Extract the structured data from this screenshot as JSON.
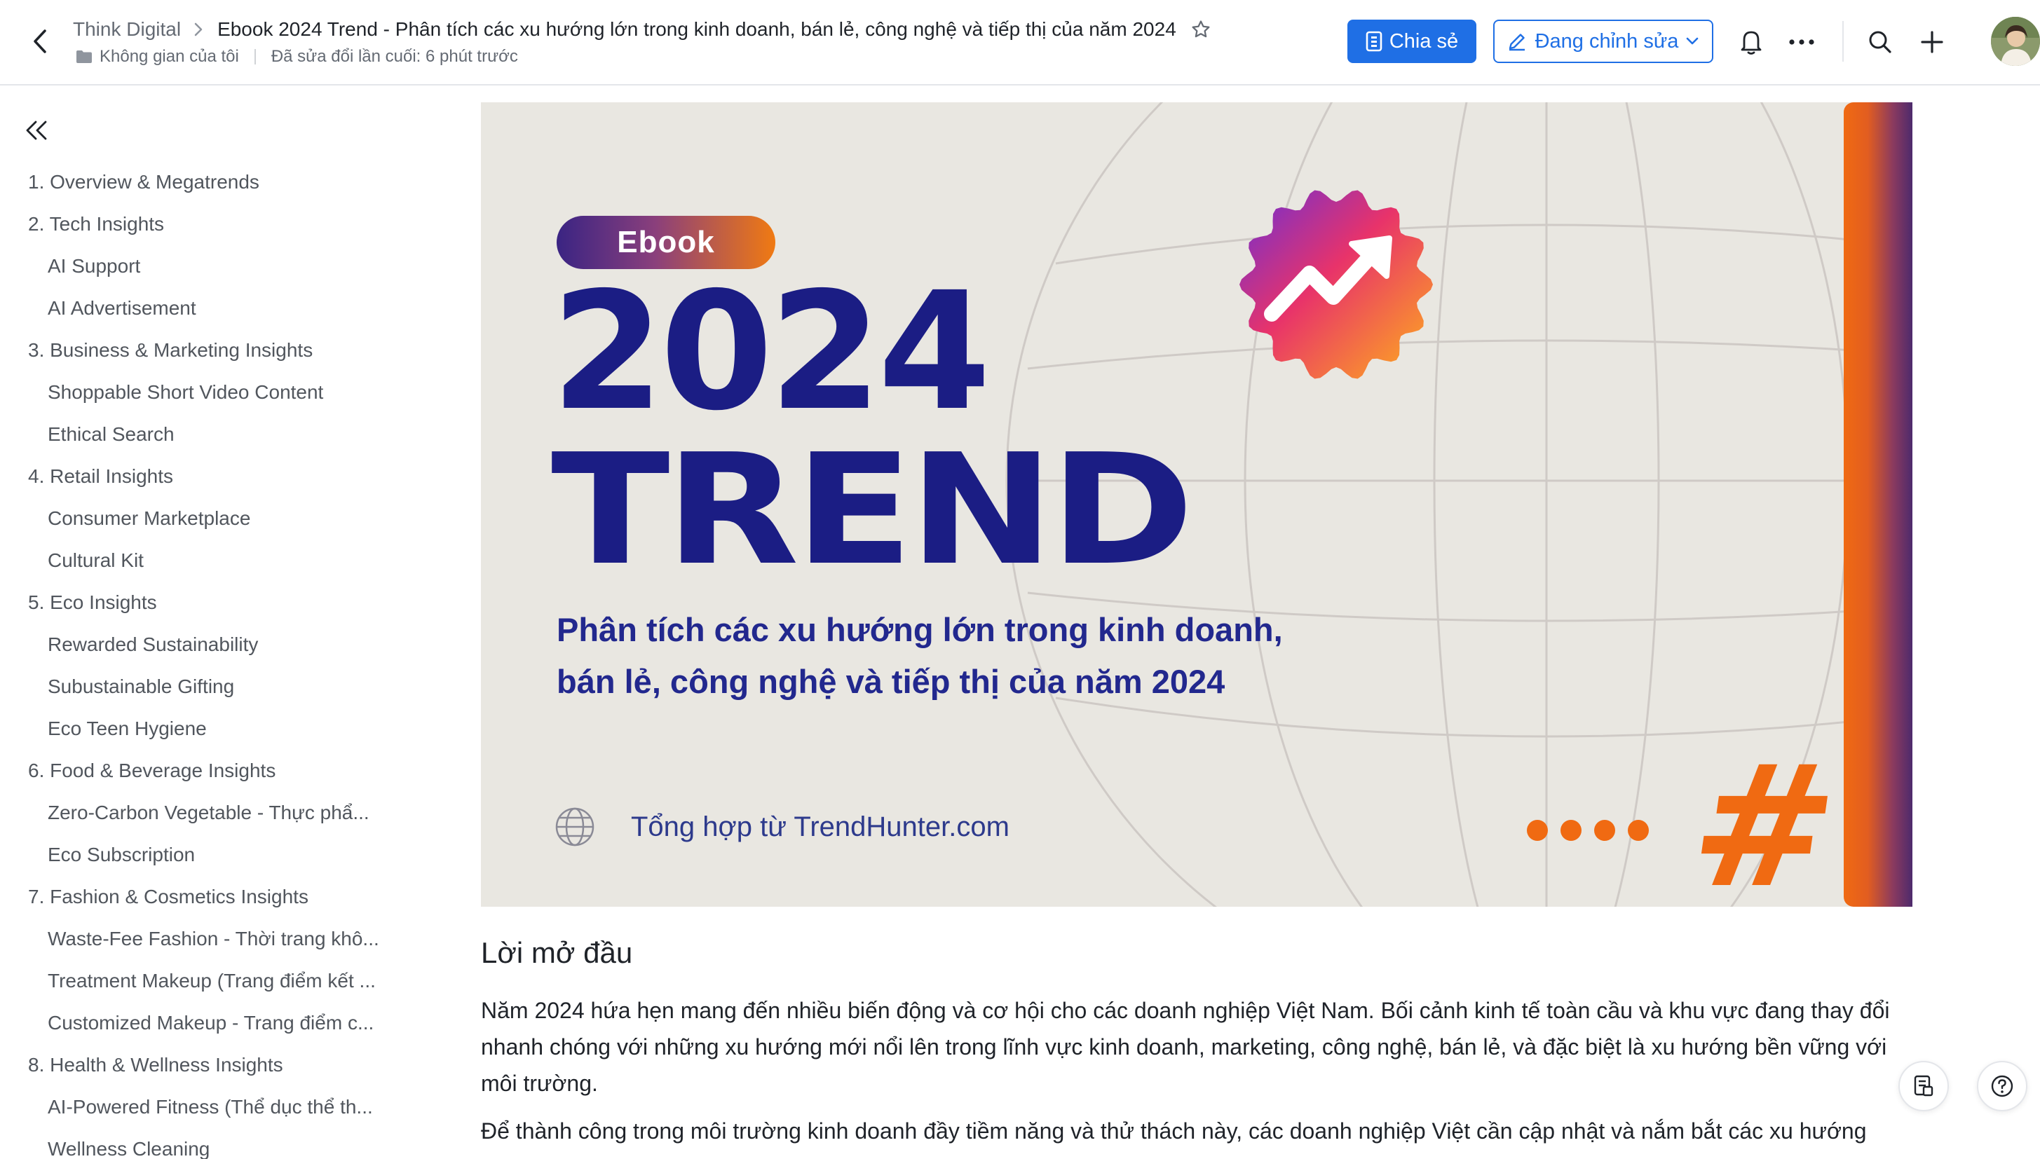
{
  "header": {
    "space_name": "Think Digital",
    "doc_title": "Ebook 2024 Trend - Phân tích các xu hướng lớn trong kinh doanh, bán lẻ, công nghệ và tiếp thị của năm 2024",
    "folder_label": "Không gian của tôi",
    "last_edited": "Đã sửa đổi lần cuối: 6 phút trước",
    "share_label": "Chia sẻ",
    "edit_mode_label": "Đang chỉnh sửa",
    "accent_color": "#1f6fe5"
  },
  "icons": {
    "back": "chevron-left-icon",
    "breadcrumb_sep": "chevron-right-icon",
    "star": "star-icon",
    "folder": "folder-icon",
    "share": "document-share-icon",
    "edit": "pencil-icon",
    "notifications": "bell-icon",
    "more": "more-horizontal-icon",
    "search": "search-icon",
    "add": "plus-icon",
    "collapse": "double-chevron-left-icon"
  },
  "sidebar": {
    "items": [
      {
        "label": "1. Overview & Megatrends",
        "level": 1
      },
      {
        "label": "2. Tech Insights",
        "level": 1
      },
      {
        "label": "AI Support",
        "level": 2
      },
      {
        "label": "AI Advertisement",
        "level": 2
      },
      {
        "label": "3. Business & Marketing Insights",
        "level": 1
      },
      {
        "label": "Shoppable Short Video Content",
        "level": 2
      },
      {
        "label": "Ethical Search",
        "level": 2
      },
      {
        "label": "4. Retail Insights",
        "level": 1
      },
      {
        "label": "Consumer Marketplace",
        "level": 2
      },
      {
        "label": "Cultural Kit",
        "level": 2
      },
      {
        "label": "5. Eco Insights",
        "level": 1
      },
      {
        "label": "Rewarded Sustainability",
        "level": 2
      },
      {
        "label": "Subustainable Gifting",
        "level": 2
      },
      {
        "label": "Eco Teen Hygiene",
        "level": 2
      },
      {
        "label": "6. Food & Beverage Insights",
        "level": 1
      },
      {
        "label": "Zero-Carbon Vegetable - Thực phẩ...",
        "level": 2
      },
      {
        "label": "Eco Subscription",
        "level": 2
      },
      {
        "label": "7. Fashion & Cosmetics Insights",
        "level": 1
      },
      {
        "label": "Waste-Fee Fashion - Thời trang khô...",
        "level": 2
      },
      {
        "label": "Treatment Makeup (Trang điểm kết ...",
        "level": 2
      },
      {
        "label": "Customized Makeup - Trang điểm c...",
        "level": 2
      },
      {
        "label": "8. Health & Wellness Insights",
        "level": 1
      },
      {
        "label": "AI-Powered Fitness (Thể dục thể th...",
        "level": 2
      },
      {
        "label": "Wellness Cleaning",
        "level": 2
      }
    ]
  },
  "cover": {
    "pill_text": "Ebook",
    "year": "2024",
    "headline": "TREND",
    "subtitle_line1": "Phân tích các xu hướng lớn trong kinh doanh,",
    "subtitle_line2": "bán lẻ, công nghệ và tiếp thị của năm 2024",
    "source_text": "Tổng hợp từ  TrendHunter.com",
    "hash_symbol": "#",
    "navy_color": "#1b1d84",
    "orange_color": "#f06a12",
    "background_color": "#e9e7e1"
  },
  "content": {
    "section_heading": "Lời mở đầu",
    "paragraph1": "Năm 2024 hứa hẹn mang đến nhiều biến động và cơ hội cho các doanh nghiệp Việt Nam. Bối cảnh kinh tế toàn cầu và khu vực đang thay đổi nhanh chóng với những xu hướng mới nổi lên trong lĩnh vực kinh doanh, marketing, công nghệ, bán lẻ, và đặc biệt là xu hướng bền vững với môi trường.",
    "paragraph2": "Để thành công trong môi trường kinh doanh đầy tiềm năng và thử thách này, các doanh nghiệp Việt cần cập nhật và nắm bắt các xu hướng"
  },
  "floating": {
    "doc_icon": "document-icon",
    "help_icon": "help-circle-icon"
  }
}
